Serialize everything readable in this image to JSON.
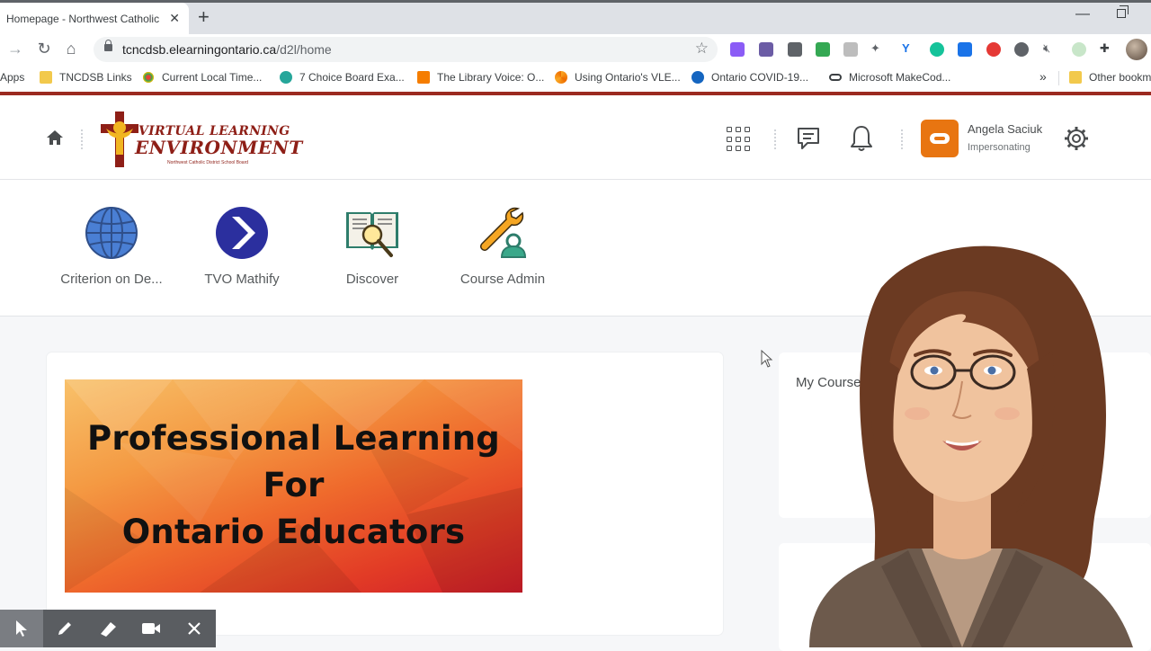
{
  "browser": {
    "tab_title": "Homepage - Northwest Catholic",
    "tab_close": "✕",
    "new_tab": "+",
    "url_host": "tcncdsb.elearningontario.ca",
    "url_path": "/d2l/home",
    "bookmarks": [
      {
        "label": "Apps",
        "icon": "apps-grid-icon"
      },
      {
        "label": "TNCDSB Links",
        "icon": "folder-icon"
      },
      {
        "label": "Current Local Time...",
        "icon": "dots-icon"
      },
      {
        "label": "7 Choice Board Exa...",
        "icon": "teal-circle-icon"
      },
      {
        "label": "The Library Voice: O...",
        "icon": "blogger-icon"
      },
      {
        "label": "Using Ontario's VLE...",
        "icon": "pinwheel-icon"
      },
      {
        "label": "Ontario COVID-19...",
        "icon": "pho-icon"
      },
      {
        "label": "Microsoft MakeCod...",
        "icon": "link-icon"
      },
      {
        "label": "Other bookm",
        "icon": "folder-icon"
      }
    ],
    "bookmarks_more": "»"
  },
  "header": {
    "logo_line1": "VIRTUAL LEARNING",
    "logo_line2": "ENVIRONMENT",
    "logo_sub": "Northwest Catholic District School Board",
    "user_name": "Angela Saciuk",
    "user_role": "Impersonating"
  },
  "nav": {
    "items": [
      {
        "label": "Criterion on De...",
        "icon": "globe-icon"
      },
      {
        "label": "TVO Mathify",
        "icon": "mathify-chevron-icon"
      },
      {
        "label": "Discover",
        "icon": "book-magnifier-icon"
      },
      {
        "label": "Course Admin",
        "icon": "wrench-person-icon"
      }
    ]
  },
  "main": {
    "banner_line1": "Professional Learning",
    "banner_line2": "For",
    "banner_line3": "Ontario Educators",
    "my_courses_title": "My Courses"
  },
  "colors": {
    "accent_red": "#9b2a20",
    "avatar_orange": "#e87511",
    "mathify_blue": "#2b2f9e"
  }
}
